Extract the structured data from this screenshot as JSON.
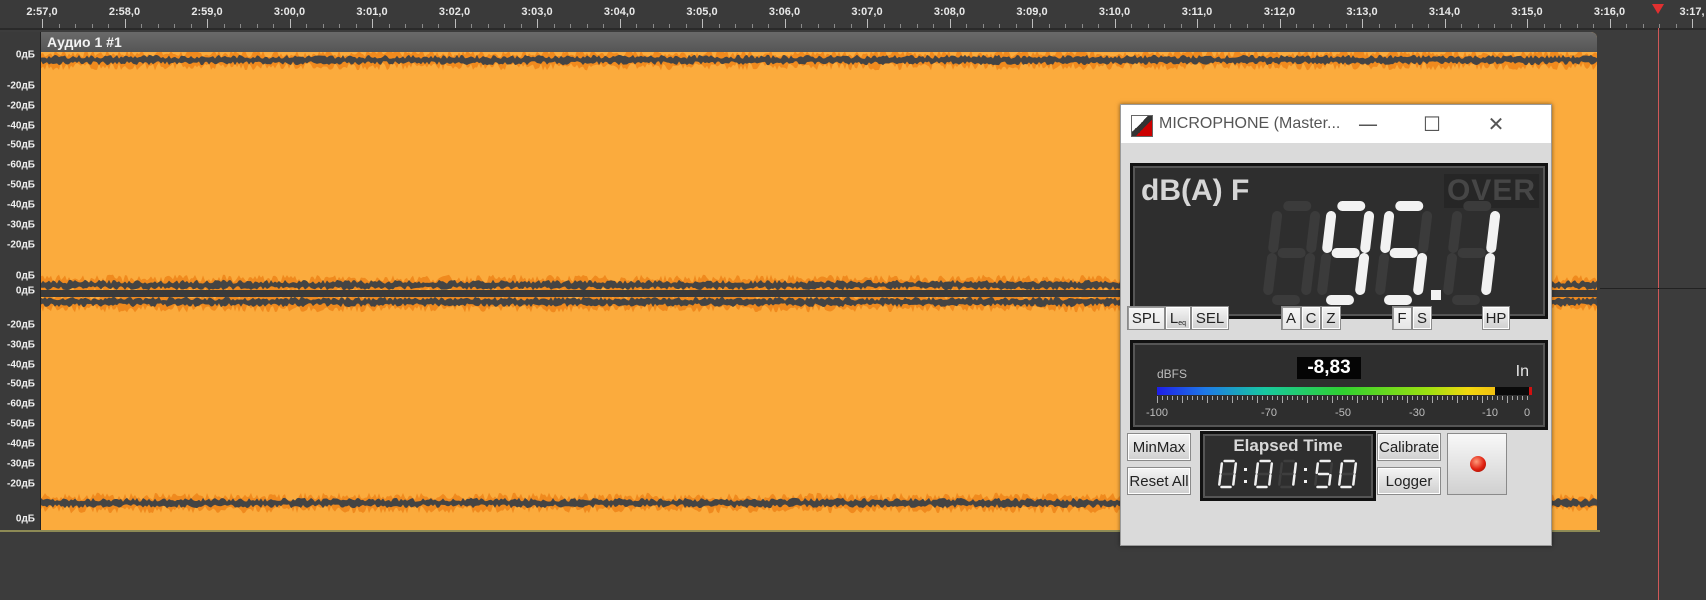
{
  "timeline": {
    "ticks": [
      "2:57,0",
      "2:58,0",
      "2:59,0",
      "3:00,0",
      "3:01,0",
      "3:02,0",
      "3:03,0",
      "3:04,0",
      "3:05,0",
      "3:06,0",
      "3:07,0",
      "3:08,0",
      "3:09,0",
      "3:10,0",
      "3:11,0",
      "3:12,0",
      "3:13,0",
      "3:14,0",
      "3:15,0",
      "3:16,0",
      "3:17,"
    ]
  },
  "track": {
    "title": "Аудио 1 #1",
    "db_labels": [
      "0дБ",
      "-20дБ",
      "-20дБ",
      "-40дБ",
      "-50дБ",
      "-60дБ",
      "-50дБ",
      "-40дБ",
      "-30дБ",
      "-20дБ",
      "0дБ",
      "0дБ",
      "-20дБ",
      "-30дБ",
      "-40дБ",
      "-50дБ",
      "-60дБ",
      "-50дБ",
      "-40дБ",
      "-30дБ",
      "-20дБ",
      "0дБ"
    ]
  },
  "meter": {
    "title": "MICROPHONE (Master...",
    "window_controls": {
      "minimize": "—",
      "maximize": "☐",
      "close": "✕"
    },
    "unit_label": "dB(A) F",
    "over_label": "OVER",
    "reading": "95.1",
    "mode_buttons": [
      "SPL",
      "L",
      "SEL"
    ],
    "leq_subscript": "eq",
    "weighting_buttons": [
      "A",
      "C",
      "Z"
    ],
    "time_buttons": [
      "F",
      "S"
    ],
    "hp_button": "HP",
    "level": {
      "unit": "dBFS",
      "value": "-8,83",
      "source": "In",
      "scale": [
        "-100",
        "-70",
        "-50",
        "-30",
        "-10",
        "0"
      ]
    },
    "buttons": {
      "minmax": "MinMax",
      "reset_all": "Reset All",
      "calibrate": "Calibrate",
      "logger": "Logger"
    },
    "elapsed": {
      "label": "Elapsed Time",
      "time": "0:01:50"
    }
  },
  "colors": {
    "waveform": "#fbab3d",
    "waveform_edge": "#f08a1e",
    "noise": "#444444",
    "lcd_background": "#2e2e2e",
    "playhead": "#e03030"
  }
}
